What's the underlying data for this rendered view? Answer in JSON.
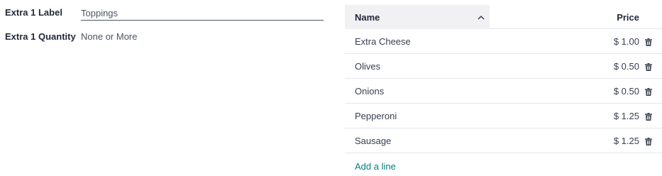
{
  "form": {
    "extra1_label": {
      "label": "Extra 1 Label",
      "value": "Toppings"
    },
    "extra1_quantity": {
      "label": "Extra 1 Quantity",
      "value": "None or More"
    }
  },
  "list": {
    "columns": {
      "name": "Name",
      "price": "Price"
    },
    "sort_icon": "chevron-up-icon",
    "rows": [
      {
        "name": "Extra Cheese",
        "price": "$ 1.00"
      },
      {
        "name": "Olives",
        "price": "$ 0.50"
      },
      {
        "name": "Onions",
        "price": "$ 0.50"
      },
      {
        "name": "Pepperoni",
        "price": "$ 1.25"
      },
      {
        "name": "Sausage",
        "price": "$ 1.25"
      }
    ],
    "delete_icon": "trash-icon",
    "add_line": "Add a line"
  },
  "colors": {
    "link": "#017e84",
    "header_bg": "#f1f1f3",
    "border": "#e5e7eb"
  }
}
